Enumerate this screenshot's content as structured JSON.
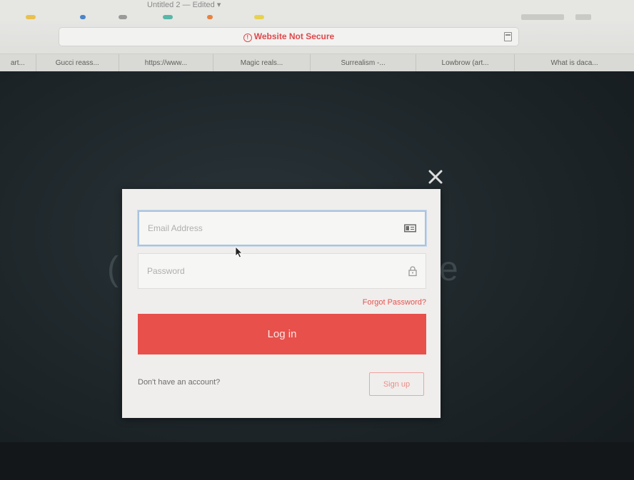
{
  "window": {
    "title": "Untitled 2 — Edited ▾"
  },
  "addressbar": {
    "security_label": "Website Not Secure",
    "warning_glyph": "!"
  },
  "bookmarks": [
    {
      "label": "art..."
    },
    {
      "label": "Gucci reass..."
    },
    {
      "label": "https://www..."
    },
    {
      "label": "Magic reals..."
    },
    {
      "label": "Surrealism -..."
    },
    {
      "label": "Lowbrow (art..."
    },
    {
      "label": "What is daca..."
    }
  ],
  "login_modal": {
    "email_placeholder": "Email Address",
    "password_placeholder": "Password",
    "forgot_password_label": "Forgot Password?",
    "login_label": "Log in",
    "no_account_text": "Don't have an account?",
    "signup_label": "Sign up"
  },
  "background_page": {
    "logo_fragment": "(",
    "title_fragment": "e"
  },
  "colors": {
    "accent": "#e8504c",
    "not_secure": "#e0484b",
    "modal_bg": "#efeeec"
  },
  "icons": {
    "email_field": "id-card-icon",
    "password_field": "lock-icon",
    "close": "close-icon"
  }
}
